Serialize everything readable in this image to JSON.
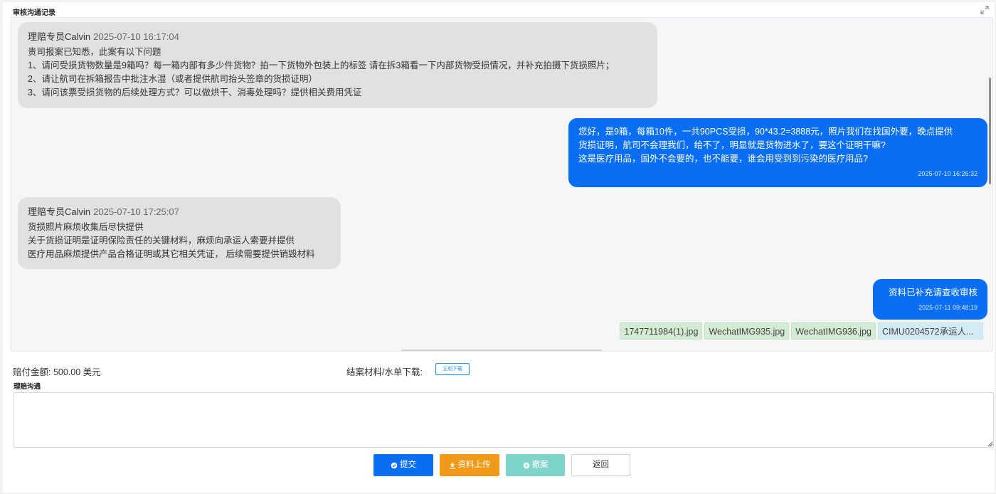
{
  "panel": {
    "title": "审核沟通记录"
  },
  "messages": {
    "m1": {
      "sender": "理赔专员Calvin",
      "time": "2025-07-10 16:17:04",
      "lines": [
        "贵司报案已知悉，此案有以下问题",
        "1、请问受损货物数量是9箱吗？每一箱内部有多少件货物？拍一下货物外包装上的标签 请在拆3箱看一下内部货物受损情况，并补充拍摄下货损照片；",
        "2、请让航司在拆箱报告中批注水湿（或者提供航司抬头签章的货损证明）",
        "3、请问该票受损货物的后续处理方式？可以做烘干、消毒处理吗？提供相关费用凭证"
      ]
    },
    "m2": {
      "lines": [
        "您好，是9箱，每箱10件，一共90PCS受损，90*43.2=3888元，照片我们在找国外要，晚点提供",
        "货损证明，航司不会理我们，给不了，明显就是货物进水了，要这个证明干嘛?",
        "这是医疗用品，国外不会要的，也不能要，谁会用受到到污染的医疗用品?"
      ],
      "time": "2025-07-10 16:26:32"
    },
    "m3": {
      "sender": "理赔专员Calvin",
      "time": "2025-07-10 17:25:07",
      "lines": [
        "货损照片麻烦收集后尽快提供",
        "关于货损证明是证明保险责任的关键材料，麻烦向承运人索要并提供",
        "医疗用品麻烦提供产品合格证明或其它相关凭证， 后续需要提供销毁材料"
      ]
    },
    "m4": {
      "lines": [
        "资料已补充请查收审核"
      ],
      "time": "2025-07-11 09:48:19"
    }
  },
  "files": [
    "1747711984(1).jpg",
    "WechatIMG935.jpg",
    "WechatIMG936.jpg",
    "CIMU0204572承运人..."
  ],
  "payment": {
    "label": "赔付金额: 500.00 美元"
  },
  "download": {
    "label": "结案材料/水单下载:",
    "button": "立刻下载"
  },
  "communication": {
    "label": "理赔沟通",
    "placeholder": ""
  },
  "buttons": {
    "submit": "提交",
    "upload": "资料上传",
    "close_case": "撤案",
    "back": "返回"
  },
  "colors": {
    "primary": "#0a6ef5",
    "warning": "#f19a1a",
    "teal": "#7fd4c9"
  },
  "icons": {
    "submit": "check-circle-icon",
    "upload": "upload-icon",
    "close_case": "cancel-circle-icon",
    "expand": "expand-icon"
  }
}
